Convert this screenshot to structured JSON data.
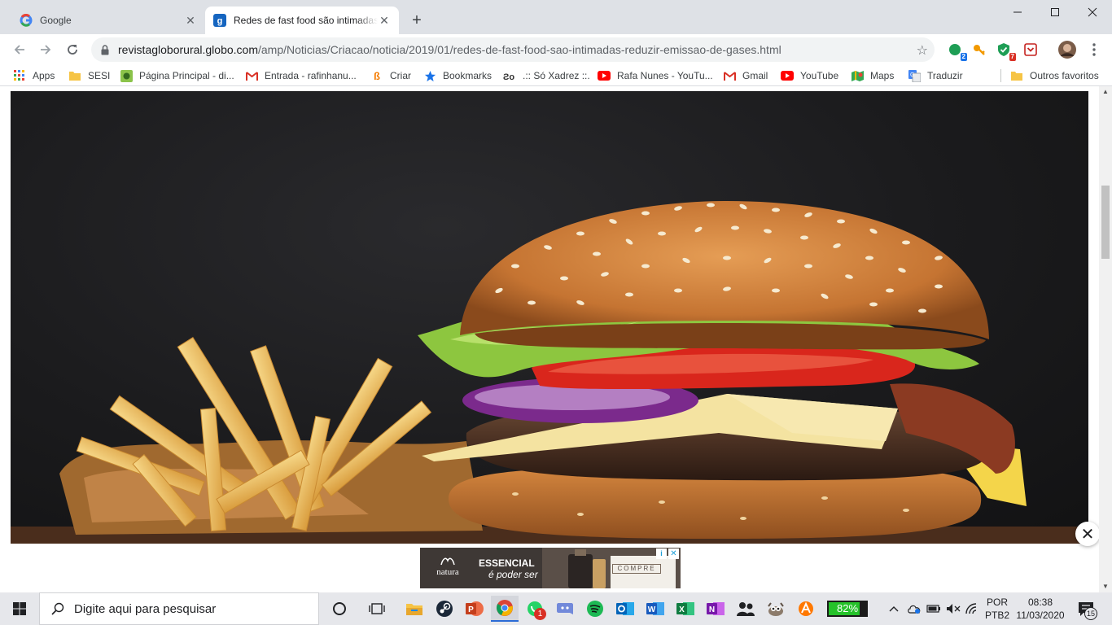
{
  "browser": {
    "tabs": [
      {
        "title": "Google",
        "favicon": "google-icon",
        "active": false
      },
      {
        "title": "Redes de fast food são intimadas",
        "favicon": "globo-icon",
        "active": true
      }
    ],
    "url": {
      "domain": "revistagloborural.globo.com",
      "path": "/amp/Noticias/Criacao/noticia/2019/01/redes-de-fast-food-sao-intimadas-reduzir-emissao-de-gases.html"
    },
    "extension_badges": {
      "ext1": "2",
      "ext3": "7"
    },
    "bookmarks": [
      {
        "label": "Apps",
        "icon": "apps-grid-icon"
      },
      {
        "label": "SESI",
        "icon": "folder-icon"
      },
      {
        "label": "Página Principal - di...",
        "icon": "page-icon"
      },
      {
        "label": "Entrada - rafinhanu...",
        "icon": "gmail-icon"
      },
      {
        "label": "Criar",
        "icon": "blogger-icon"
      },
      {
        "label": "Bookmarks",
        "icon": "star-icon"
      },
      {
        "label": ".:: Só Xadrez ::.",
        "icon": "chess-icon"
      },
      {
        "label": "Rafa Nunes - YouTu...",
        "icon": "youtube-icon"
      },
      {
        "label": "Gmail",
        "icon": "gmail-icon"
      },
      {
        "label": "YouTube",
        "icon": "youtube-icon"
      },
      {
        "label": "Maps",
        "icon": "maps-icon"
      },
      {
        "label": "Traduzir",
        "icon": "translate-icon"
      }
    ],
    "other_bookmarks": "Outros favoritos"
  },
  "page": {
    "ad": {
      "brand": "natura",
      "headline": "ESSENCIAL",
      "tagline": "é poder ser",
      "cta": "COMPRE"
    }
  },
  "taskbar": {
    "search_placeholder": "Digite aqui para pesquisar",
    "whatsapp_badge": "1",
    "battery_percent": 82,
    "battery_label": "82%",
    "language_top": "POR",
    "language_bottom": "PTB2",
    "time": "08:38",
    "date": "11/03/2020",
    "notifications": "15"
  },
  "colors": {
    "accent": "#1a73e8",
    "tabstrip": "#dee1e6",
    "taskbar": "#e6e7eb"
  }
}
